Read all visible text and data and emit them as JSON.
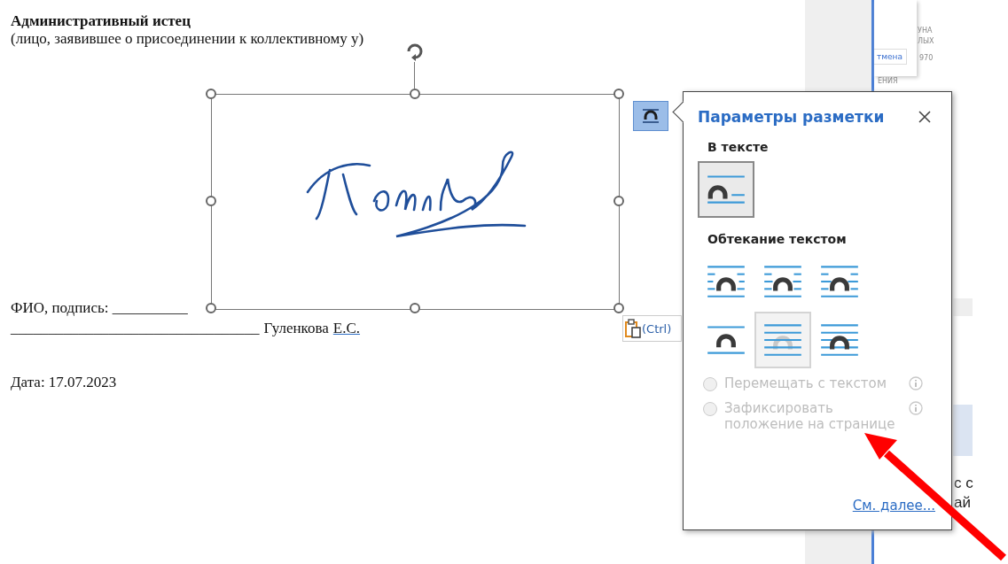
{
  "document": {
    "heading": "Административный истец",
    "subheading": "(лицо, заявившее о присоединении к коллективному у)",
    "signature_line": "ФИО, подпись: __________",
    "name_line_blank": "_________________________________",
    "name": "Гуленкова",
    "initials": "Е.С.",
    "date": "Дата: 17.07.2023"
  },
  "paste_options": {
    "label": "(Ctrl)"
  },
  "popup": {
    "title": "Параметры разметки",
    "sections": [
      {
        "title": "В тексте",
        "options": [
          {
            "kind": "inline",
            "selected": true,
            "hovered": false
          }
        ]
      },
      {
        "title": "Обтекание текстом",
        "options": [
          {
            "kind": "square",
            "selected": false,
            "hovered": false
          },
          {
            "kind": "tight",
            "selected": false,
            "hovered": false
          },
          {
            "kind": "through",
            "selected": false,
            "hovered": false
          },
          {
            "kind": "topbottom",
            "selected": false,
            "hovered": false
          },
          {
            "kind": "behind",
            "selected": false,
            "hovered": true
          },
          {
            "kind": "front",
            "selected": false,
            "hovered": false
          }
        ]
      }
    ],
    "radios": [
      {
        "label": "Перемещать с текстом",
        "selected": false,
        "disabled": true
      },
      {
        "label": "Зафиксировать положение на странице",
        "selected": false,
        "disabled": true
      }
    ],
    "link": "См. далее..."
  },
  "background_window": {
    "button": "тмена",
    "fragments": [
      "УНА",
      "ЛЫХ",
      "970",
      "ЕНИЯ",
      "с с",
      "ай"
    ]
  }
}
